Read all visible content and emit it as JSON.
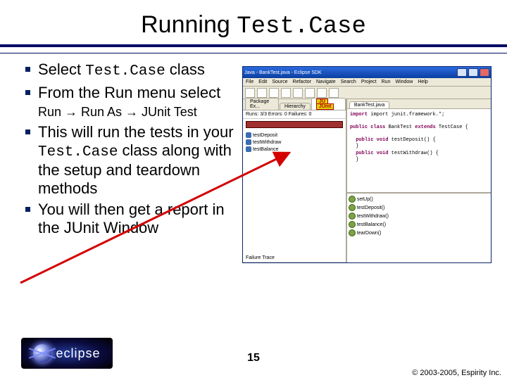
{
  "title_plain": "Running ",
  "title_code": "Test.Case",
  "bullets": {
    "b1_pre": "Select ",
    "b1_code": "Test.Case",
    "b1_post": " class",
    "b2_pre": "From the Run menu select ",
    "b2_menu": "Run → Run As → JUnit Test",
    "b3_pre": "This will run the tests in your ",
    "b3_code": "Test.Case",
    "b3_post": " class along with the setup and teardown methods",
    "b4": "You will then get a report in the JUnit Window"
  },
  "ide": {
    "window_title": "Java - BankTest.java - Eclipse SDK",
    "menu": [
      "File",
      "Edit",
      "Source",
      "Refactor",
      "Navigate",
      "Search",
      "Project",
      "Run",
      "Window",
      "Help"
    ],
    "tabs_left": [
      "Package Ex...",
      "Hierarchy",
      "JUnit"
    ],
    "junit_tab": "JU",
    "stats": "Runs: 3/3   Errors: 0   Failures: 0",
    "tests": [
      "testDeposit",
      "testWithdraw",
      "testBalance"
    ],
    "failure_trace": "Failure Trace",
    "editor_tab": "BankTest.java",
    "code_import": "import junit.framework.*;",
    "code_class_kw": "public class ",
    "code_class": "BankTest ",
    "code_ext_kw": "extends",
    "code_ext": " TestCase {",
    "code_m1_kw": "public void ",
    "code_m1": "testDeposit() {",
    "code_m2_kw": "public void ",
    "code_m2": "testWithdraw() {",
    "outline": [
      "setUp()",
      "testDeposit()",
      "testWithdraw()",
      "testBalance()",
      "tearDown()"
    ]
  },
  "logo": "eclipse",
  "page": "15",
  "copyright": "© 2003-2005, Espirity Inc."
}
